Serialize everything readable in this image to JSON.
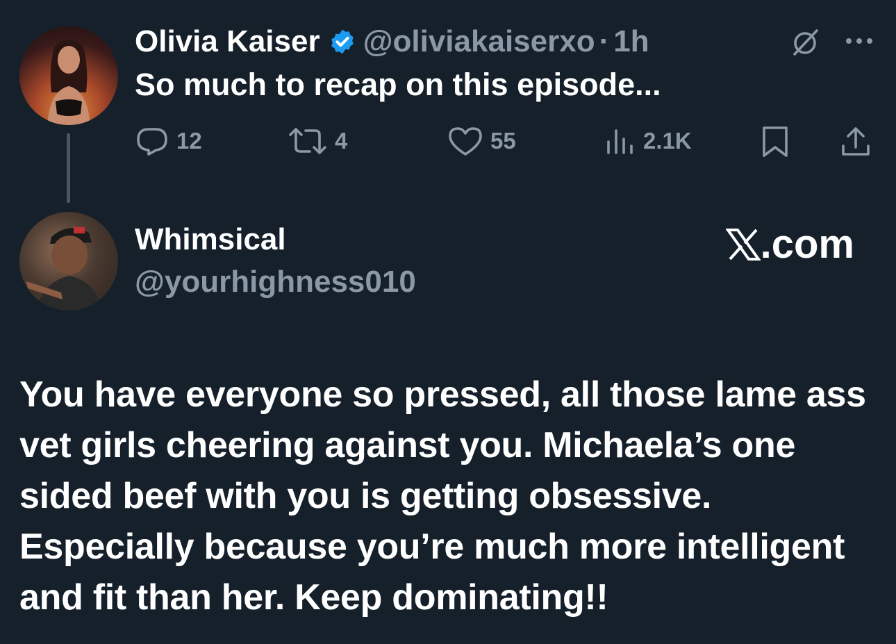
{
  "original_tweet": {
    "author_name": "Olivia Kaiser",
    "author_handle": "@oliviakaiserxo",
    "separator": "·",
    "time": "1h",
    "text": "So much to recap on this episode...",
    "verified": true,
    "actions": {
      "replies": "12",
      "retweets": "4",
      "likes": "55",
      "views": "2.1K"
    }
  },
  "reply": {
    "author_name": "Whimsical",
    "author_handle": "@yourhighness010",
    "text": "You have everyone so pressed, all those lame ass vet girls cheering against you. Michaela’s one sided beef with you is getting obsessive. Especially because you’re much more intelligent and fit than her. Keep dominating!!"
  },
  "brand": {
    "label": ".com",
    "logo_letter": "X"
  },
  "colors": {
    "background": "#15202b",
    "text": "#ffffff",
    "muted": "#8b98a5",
    "verified": "#1d9bf0"
  },
  "icons": [
    "grok-icon",
    "more-icon",
    "reply-icon",
    "retweet-icon",
    "like-icon",
    "views-icon",
    "bookmark-icon",
    "share-icon",
    "verified-badge-icon",
    "x-logo-icon"
  ]
}
